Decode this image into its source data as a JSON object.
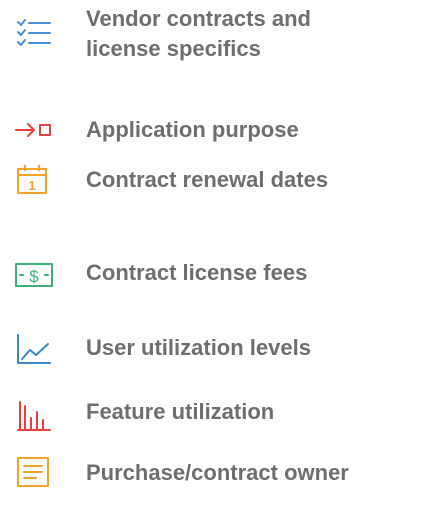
{
  "items": [
    {
      "icon": "checklist-icon",
      "color": "#4a90d9",
      "lines": [
        "Vendor contracts and",
        "license specifics"
      ]
    },
    {
      "icon": "arrow-to-box-icon",
      "color": "#e8403f",
      "lines": [
        "Application purpose"
      ]
    },
    {
      "icon": "calendar-icon",
      "color": "#f3a32a",
      "lines": [
        "Contract renewal dates"
      ]
    },
    {
      "icon": "dollar-bill-icon",
      "color": "#3fb07a",
      "lines": [
        "Contract license fees"
      ]
    },
    {
      "icon": "line-chart-icon",
      "color": "#3b87c9",
      "lines": [
        "User utilization levels"
      ]
    },
    {
      "icon": "bar-chart-icon",
      "color": "#e8403f",
      "lines": [
        "Feature utilization"
      ]
    },
    {
      "icon": "document-icon",
      "color": "#f3a32a",
      "lines": [
        "Purchase/contract owner"
      ]
    }
  ],
  "icon_glyphs": {
    "calendar_day": "1",
    "dollar_sign": "$"
  }
}
